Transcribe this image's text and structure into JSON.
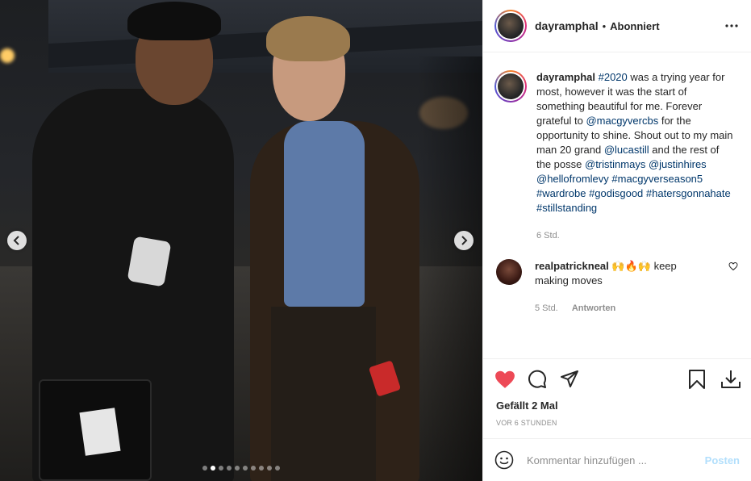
{
  "post": {
    "photo_index": 2,
    "photo_count": 10,
    "image_description": "Two men posing at night in front of a canopy tent"
  },
  "header": {
    "username": "dayramphal",
    "separator": "•",
    "follow_status": "Abonniert"
  },
  "caption": {
    "username": "dayramphal",
    "segments": [
      {
        "text": "#2020",
        "link": true
      },
      {
        "text": " was a trying year for most, however it was the start of something beautiful for me. Forever grateful to ",
        "link": false
      },
      {
        "text": "@macgyvercbs",
        "link": true
      },
      {
        "text": " for the opportunity to shine. Shout out to my main man 20 grand ",
        "link": false
      },
      {
        "text": "@lucastill",
        "link": true
      },
      {
        "text": " and the rest of the posse ",
        "link": false
      },
      {
        "text": "@tristinmays",
        "link": true
      },
      {
        "text": " ",
        "link": false
      },
      {
        "text": "@justinhires",
        "link": true
      },
      {
        "text": " ",
        "link": false
      },
      {
        "text": "@hellofromlevy",
        "link": true
      },
      {
        "text": " ",
        "link": false
      },
      {
        "text": "#macgyverseason5",
        "link": true
      },
      {
        "text": " ",
        "link": false
      },
      {
        "text": "#wardrobe",
        "link": true
      },
      {
        "text": " ",
        "link": false
      },
      {
        "text": "#godisgood",
        "link": true
      },
      {
        "text": " ",
        "link": false
      },
      {
        "text": "#hatersgonnahate",
        "link": true
      },
      {
        "text": " ",
        "link": false
      },
      {
        "text": "#stillstanding",
        "link": true
      }
    ],
    "time": "6 Std."
  },
  "comments": [
    {
      "username": "realpatrickneal",
      "text": "🙌🔥🙌 keep making moves",
      "time": "5 Std.",
      "reply_label": "Antworten"
    }
  ],
  "actions": {
    "liked": true,
    "like_color": "#ed4956"
  },
  "likes_text": "Gefällt 2 Mal",
  "timestamp": "VOR 6 STUNDEN",
  "add_comment": {
    "placeholder": "Kommentar hinzufügen ...",
    "post_label": "Posten",
    "post_color": "#b2dffc"
  },
  "icons": {
    "prev": "chevron-left-icon",
    "next": "chevron-right-icon",
    "more": "more-horizontal-icon",
    "like": "heart-icon",
    "comment": "comment-icon",
    "share": "paper-plane-icon",
    "save": "bookmark-icon",
    "download": "download-icon",
    "emoji": "smiley-icon"
  }
}
